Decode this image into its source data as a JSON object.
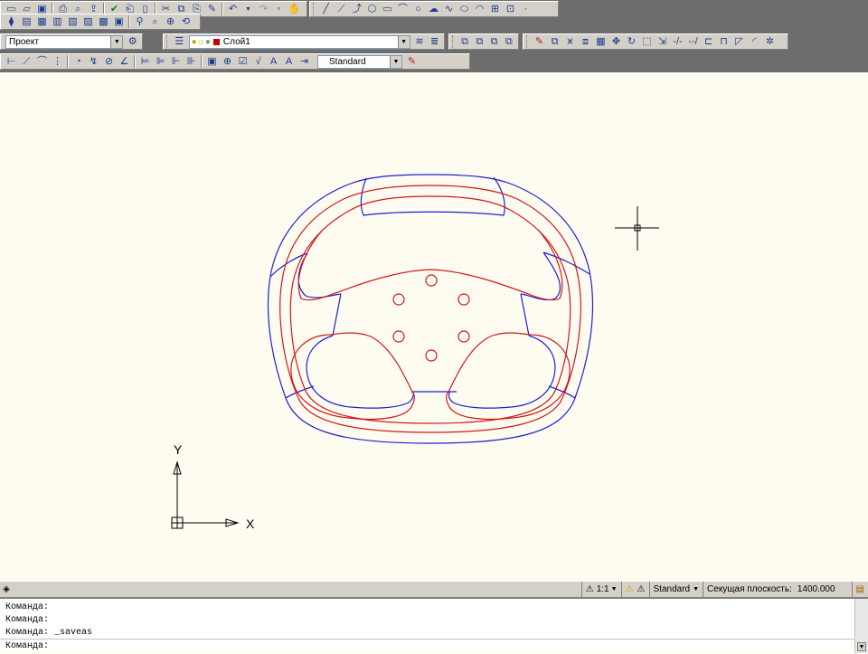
{
  "toolbar": {
    "workspace": "Проект",
    "layer": "Слой1",
    "dim_style": "Standard",
    "icons_row1": [
      "new-icon",
      "open-icon",
      "save-icon",
      "print-icon",
      "preview-icon",
      "publish-icon",
      "check-icon",
      "plot-icon",
      "copy-icon",
      "cut-icon",
      "paste-icon",
      "matchprop-icon",
      "undo-icon",
      "redo-icon",
      "pan-icon",
      "line-icon",
      "pline-icon",
      "arc-icon",
      "circle-icon",
      "spline-icon",
      "ellipse-icon",
      "block-icon",
      "point-icon"
    ],
    "icons_row2": [
      "layer-states-icon",
      "properties-icon",
      "designcenter-icon",
      "toolpalette-icon",
      "sheetset-icon",
      "markup-icon",
      "calc-icon",
      "zoom-realtime-icon",
      "zoom-window-icon",
      "zoom-previous-icon"
    ],
    "icons_row3": [
      "linear-dim-icon",
      "aligned-dim-icon",
      "arc-dim-icon",
      "ordinate-dim-icon",
      "radius-dim-icon",
      "jogged-dim-icon",
      "diameter-dim-icon",
      "angular-dim-icon",
      "quick-dim-icon",
      "baseline-dim-icon",
      "continue-dim-icon",
      "space-dim-icon",
      "break-dim-icon",
      "tolerance-icon",
      "center-mark-icon",
      "inspect-icon",
      "jogged-linear-icon",
      "edit-dim-icon",
      "edit-text-icon",
      "update-icon"
    ],
    "icons_modify": [
      "erase-icon",
      "copy-obj-icon",
      "mirror-icon",
      "offset-icon",
      "array-icon",
      "move-icon",
      "rotate-icon",
      "scale-icon",
      "stretch-icon",
      "trim-icon",
      "extend-icon",
      "break-icon",
      "join-icon",
      "chamfer-icon",
      "fillet-icon",
      "explode-icon"
    ]
  },
  "ucs": {
    "x_label": "X",
    "y_label": "Y"
  },
  "status": {
    "annotation_scale": "1:1",
    "visual_style": "Standard",
    "section_plane_label": "Секущая плоскость:",
    "section_plane_value": "1400.000"
  },
  "command": {
    "history": [
      "Команда:",
      "Команда:",
      "Команда:  _saveas"
    ],
    "prompt": "Команда:"
  },
  "colors": {
    "outer_profile": "#1f1fcf",
    "inner_profile": "#d01818",
    "canvas": "#fefcf0"
  }
}
